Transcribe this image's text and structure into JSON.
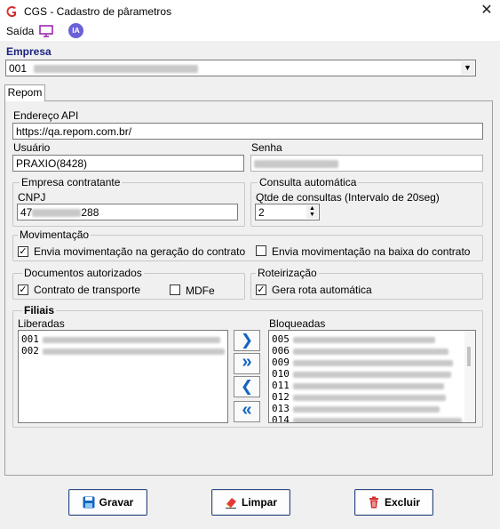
{
  "window": {
    "title": "CGS - Cadastro de pârametros",
    "close_glyph": "✕"
  },
  "menu": {
    "exit_label": "Saída",
    "ia_badge": "IA"
  },
  "empresa": {
    "label": "Empresa",
    "selected_code": "001"
  },
  "tabs": [
    {
      "label": "Repom"
    }
  ],
  "repom": {
    "endpoint_label": "Endereço API",
    "endpoint_value": "https://qa.repom.com.br/",
    "user_label": "Usuário",
    "user_value": "PRAXIO(8428)",
    "password_label": "Senha",
    "contracting_group": "Empresa contratante",
    "cnpj_label": "CNPJ",
    "cnpj_prefix": "47",
    "cnpj_suffix": "288",
    "auto_query_group": "Consulta automática",
    "query_count_label": "Qtde de consultas (Intervalo de 20seg)",
    "query_count_value": "2",
    "movement_group": "Movimentação",
    "move_on_generate_label": "Envia movimentação na geração do contrato",
    "move_on_generate_checked": true,
    "move_on_close_label": "Envia movimentação na baixa do contrato",
    "move_on_close_checked": false,
    "docs_group": "Documentos autorizados",
    "doc_transport_label": "Contrato de transporte",
    "doc_transport_checked": true,
    "doc_mdfe_label": "MDFe",
    "doc_mdfe_checked": false,
    "routing_group": "Roteirização",
    "auto_route_label": "Gera rota automática",
    "auto_route_checked": true,
    "branches_group": "Filiais",
    "released_label": "Liberadas",
    "blocked_label": "Bloqueadas",
    "released_items": [
      {
        "code": "001"
      },
      {
        "code": "002"
      }
    ],
    "blocked_items": [
      {
        "code": "005"
      },
      {
        "code": "006"
      },
      {
        "code": "009"
      },
      {
        "code": "010"
      },
      {
        "code": "011"
      },
      {
        "code": "012"
      },
      {
        "code": "013"
      },
      {
        "code": "014"
      }
    ],
    "move_one_right": "❯",
    "move_all_right": "»",
    "move_one_left": "❮",
    "move_all_left": "«"
  },
  "actions": {
    "save_label": "Gravar",
    "clear_label": "Limpar",
    "delete_label": "Excluir"
  },
  "icons": [
    "app-logo-icon",
    "monitor-icon",
    "ia-icon",
    "chevron-down-icon",
    "floppy-disk-icon",
    "eraser-icon",
    "trash-icon",
    "close-icon"
  ],
  "colors": {
    "accent": "#1565c0",
    "empresa_label": "#1a237e",
    "save_icon": "#1565c0",
    "delete_icon": "#d32f2f",
    "eraser_icon": "#e53935",
    "logo": "#d32f2f"
  }
}
